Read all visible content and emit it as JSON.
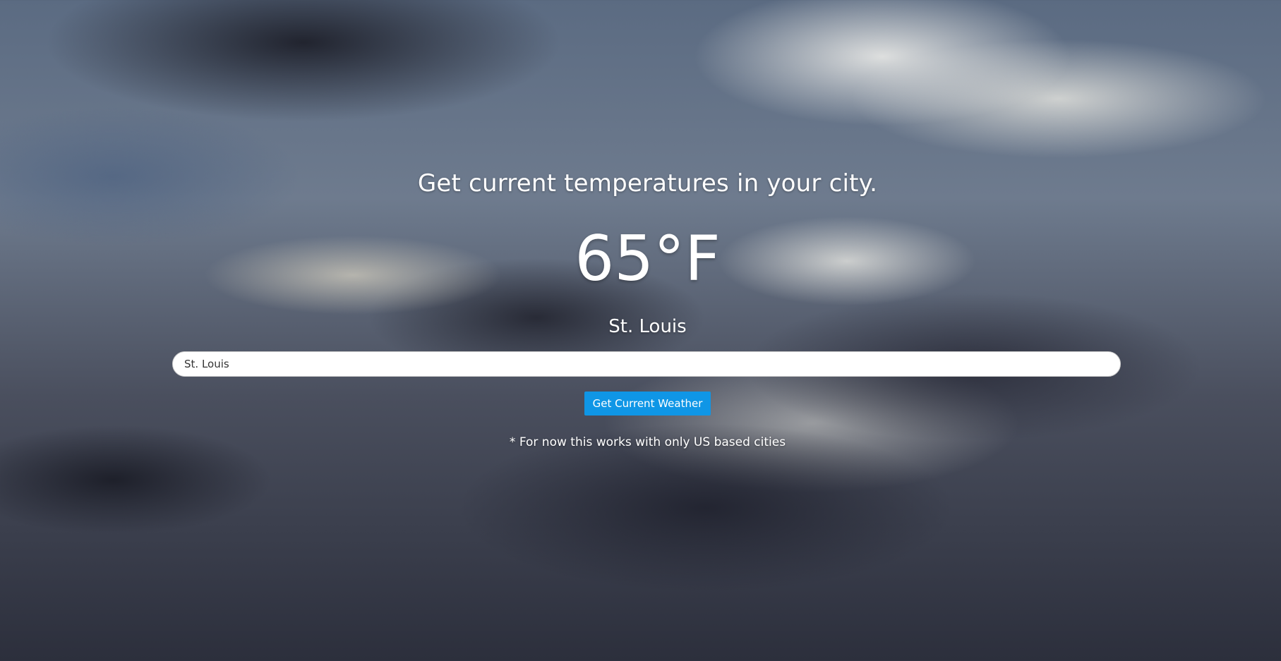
{
  "page": {
    "headline": "Get current temperatures in your city.",
    "footnote": "* For now this works with only US based cities"
  },
  "weather": {
    "temperature": "65°F",
    "city": "St. Louis"
  },
  "search": {
    "value": "St. Louis",
    "button_label": "Get Current Weather"
  },
  "colors": {
    "button_background": "#0f96e6",
    "text": "#ffffff",
    "input_background": "#ffffff"
  },
  "background": {
    "image": "cloudy-sky"
  }
}
